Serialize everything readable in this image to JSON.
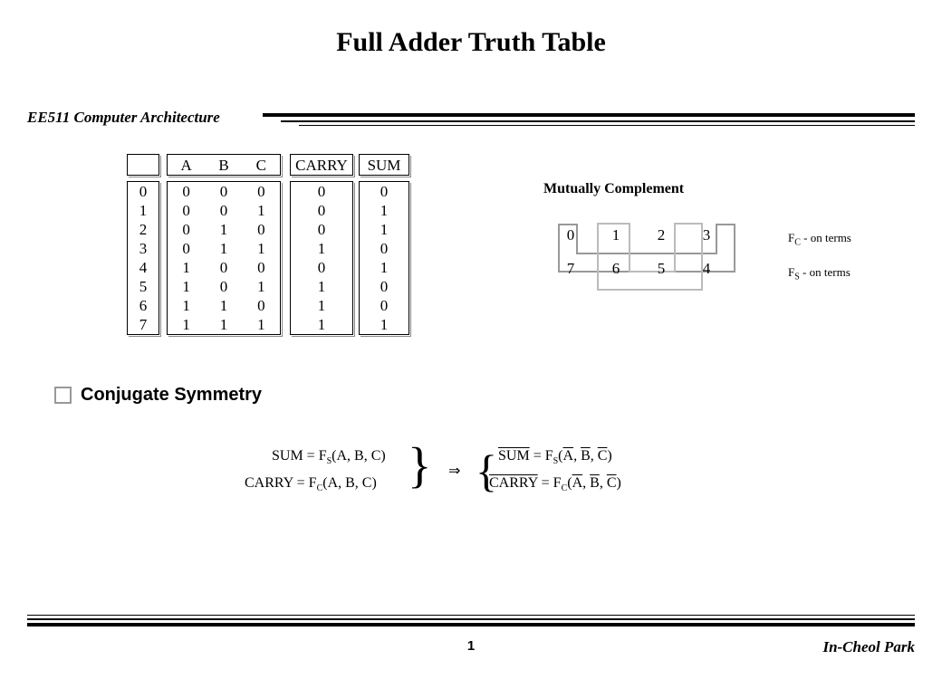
{
  "course": "EE511 Computer Architecture",
  "title": "Full Adder Truth Table",
  "headers": {
    "a": "A",
    "b": "B",
    "c": "C",
    "carry": "CARRY",
    "sum": "SUM"
  },
  "rows": [
    {
      "i": "0",
      "a": "0",
      "b": "0",
      "c": "0",
      "carry": "0",
      "sum": "0"
    },
    {
      "i": "1",
      "a": "0",
      "b": "0",
      "c": "1",
      "carry": "0",
      "sum": "1"
    },
    {
      "i": "2",
      "a": "0",
      "b": "1",
      "c": "0",
      "carry": "0",
      "sum": "1"
    },
    {
      "i": "3",
      "a": "0",
      "b": "1",
      "c": "1",
      "carry": "1",
      "sum": "0"
    },
    {
      "i": "4",
      "a": "1",
      "b": "0",
      "c": "0",
      "carry": "0",
      "sum": "1"
    },
    {
      "i": "5",
      "a": "1",
      "b": "0",
      "c": "1",
      "carry": "1",
      "sum": "0"
    },
    {
      "i": "6",
      "a": "1",
      "b": "1",
      "c": "0",
      "carry": "1",
      "sum": "0"
    },
    {
      "i": "7",
      "a": "1",
      "b": "1",
      "c": "1",
      "carry": "1",
      "sum": "1"
    }
  ],
  "mc": "Mutually Complement",
  "diag": {
    "top": [
      "0",
      "1",
      "2",
      "3"
    ],
    "bot": [
      "7",
      "6",
      "5",
      "4"
    ]
  },
  "fc": "F",
  "fc_sub": "C",
  "fc_rest": " - on terms",
  "fs": "F",
  "fs_sub": "S",
  "fs_rest": " - on terms",
  "bullet": "Conjugate Symmetry",
  "eq": {
    "l1a": "SUM = F",
    "l1b": "S",
    "l1c": "(A, B, C)",
    "l2a": "CARRY = F",
    "l2b": "C",
    "l2c": "(A, B, C)",
    "r1a": "SUM",
    "r1b": " = F",
    "r1c": "S",
    "r1d": "(",
    "r1e": "A",
    "r1f": ", ",
    "r1g": "B",
    "r1h": ", ",
    "r1i": "C",
    "r1j": ")",
    "r2a": "CARRY",
    "r2b": " = F",
    "r2c": "C",
    "r2d": "(",
    "r2e": "A",
    "r2f": ", ",
    "r2g": "B",
    "r2h": ", ",
    "r2i": "C",
    "r2j": ")"
  },
  "page": "1",
  "author": "In-Cheol Park"
}
